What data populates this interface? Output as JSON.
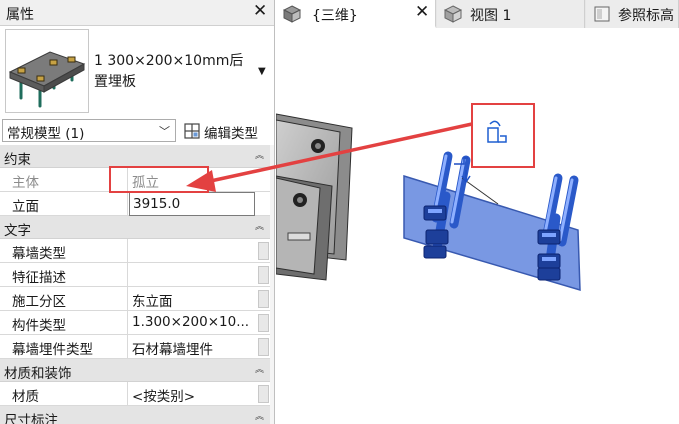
{
  "properties": {
    "title": "属性",
    "type_selector": {
      "name": "1  300×200×10mm后置埋板"
    },
    "filter": {
      "value": "常规模型 (1)"
    },
    "edit_type_label": "编辑类型",
    "groups": [
      {
        "label": "约束",
        "rows": [
          {
            "key": "主体",
            "value": "孤立",
            "disabled": true
          },
          {
            "key": "立面",
            "value": "3915.0",
            "editing": true
          }
        ]
      },
      {
        "label": "文字",
        "rows": [
          {
            "key": "幕墙类型",
            "value": ""
          },
          {
            "key": "特征描述",
            "value": ""
          },
          {
            "key": "施工分区",
            "value": "东立面"
          },
          {
            "key": "构件类型",
            "value": "1.300×200×10..."
          },
          {
            "key": "幕墙埋件类型",
            "value": "石材幕墙埋件"
          }
        ]
      },
      {
        "label": "材质和装饰",
        "rows": [
          {
            "key": "材质",
            "value": "<按类别>"
          }
        ]
      },
      {
        "label": "尺寸标注",
        "rows": []
      }
    ]
  },
  "tabs": [
    {
      "label": "{三维}",
      "active": true,
      "icon": "cube-3d-icon",
      "closable": true
    },
    {
      "label": "视图 1",
      "active": false,
      "icon": "cube-3d-icon"
    },
    {
      "label": "参照标高",
      "active": false,
      "icon": "sheet-view-icon"
    }
  ],
  "colors": {
    "annotation_red": "#e34141",
    "selection_blue": "#3f6fd8",
    "panel_header": "#e4e4e4"
  }
}
